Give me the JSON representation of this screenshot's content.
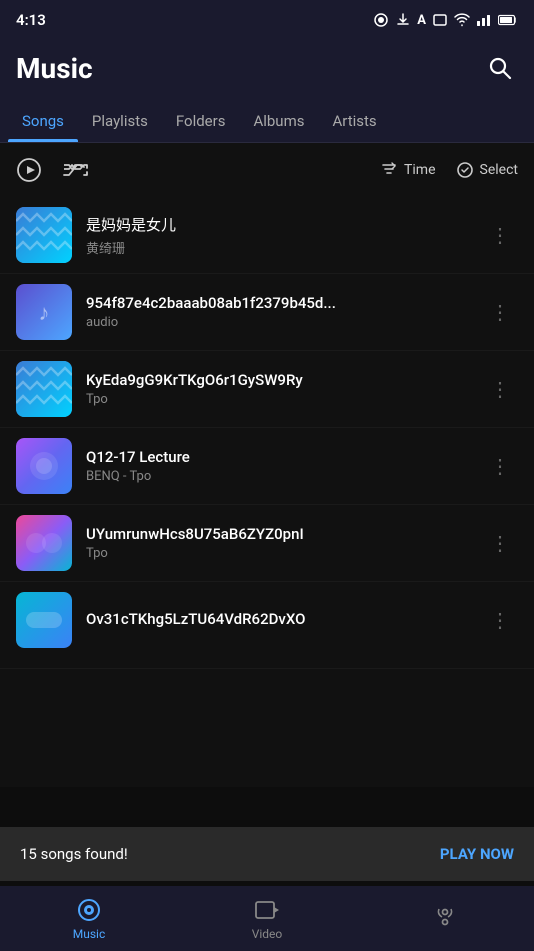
{
  "statusBar": {
    "time": "4:13"
  },
  "header": {
    "title": "Music",
    "searchLabel": "Search"
  },
  "tabs": [
    {
      "label": "Songs",
      "active": true
    },
    {
      "label": "Playlists",
      "active": false
    },
    {
      "label": "Folders",
      "active": false
    },
    {
      "label": "Albums",
      "active": false
    },
    {
      "label": "Artists",
      "active": false
    }
  ],
  "controls": {
    "playLabel": "Play",
    "shuffleLabel": "Shuffle",
    "sortLabel": "Time",
    "selectLabel": "Select"
  },
  "songs": [
    {
      "title": "是妈妈是女儿",
      "artist": "黄绮珊",
      "thumb": "pattern1"
    },
    {
      "title": "954f87e4c2baaab08ab1f2379b45d...",
      "artist": "audio",
      "thumb": "gradient1"
    },
    {
      "title": "KyEda9gG9KrTKgO6r1GySW9Ry",
      "artist": "Tpo",
      "thumb": "pattern2"
    },
    {
      "title": "Q12-17 Lecture",
      "artist": "BENQ - Tpo",
      "thumb": "gradient2"
    },
    {
      "title": "UYumrunwHcs8U75aB6ZYZ0pnI",
      "artist": "Tpo",
      "thumb": "gradient3"
    },
    {
      "title": "Ov31cTKhg5LzTU64VdR62DvXO",
      "artist": "",
      "thumb": "gradient4"
    }
  ],
  "snackbar": {
    "text": "15 songs found!",
    "actionLabel": "PLAY NOW"
  },
  "bottomNav": [
    {
      "label": "Music",
      "active": true
    },
    {
      "label": "Video",
      "active": false
    },
    {
      "label": "",
      "active": false
    }
  ]
}
